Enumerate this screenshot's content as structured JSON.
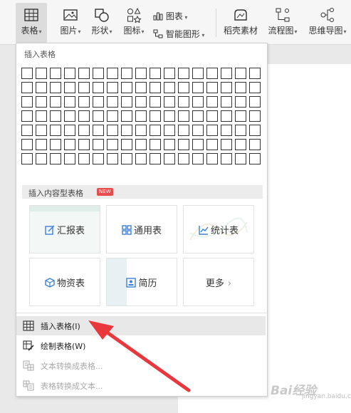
{
  "ribbon": {
    "table_label": "表格",
    "picture_label": "图片",
    "shape_label": "形状",
    "icon_label": "图标",
    "chart_label": "图表",
    "smartart_label": "智能图形",
    "docer_label": "稻壳素材",
    "flowchart_label": "流程图",
    "mindmap_label": "思维导图"
  },
  "menu": {
    "insert_table_title": "插入表格",
    "grid": {
      "rows": 7,
      "cols": 17
    },
    "content_table_header": "插入内容型表格",
    "new_badge": "NEW",
    "cards": [
      {
        "label": "汇报表",
        "icon": "report-icon"
      },
      {
        "label": "通用表",
        "icon": "grid-icon"
      },
      {
        "label": "统计表",
        "icon": "line-chart-icon"
      },
      {
        "label": "物资表",
        "icon": "box-icon"
      },
      {
        "label": "简历",
        "icon": "resume-icon"
      },
      {
        "label": "更多",
        "icon": "chevron-right-icon"
      }
    ],
    "items": [
      {
        "label": "插入表格(I)",
        "icon": "table-icon",
        "enabled": true,
        "highlighted": true
      },
      {
        "label": "绘制表格(W)",
        "icon": "draw-table-icon",
        "enabled": true,
        "highlighted": false
      },
      {
        "label": "文本转换成表格...",
        "icon": "text-to-table-icon",
        "enabled": false,
        "highlighted": false
      },
      {
        "label": "表格转换成文本...",
        "icon": "table-to-text-icon",
        "enabled": false,
        "highlighted": false
      }
    ]
  },
  "watermark": {
    "brand": "Bai",
    "brand2": "经验",
    "sub": "jingyan.baidu.com"
  },
  "colors": {
    "accent_blue": "#3b7fd6",
    "arrow_red": "#e8383d",
    "badge_red": "#e84d4d"
  }
}
